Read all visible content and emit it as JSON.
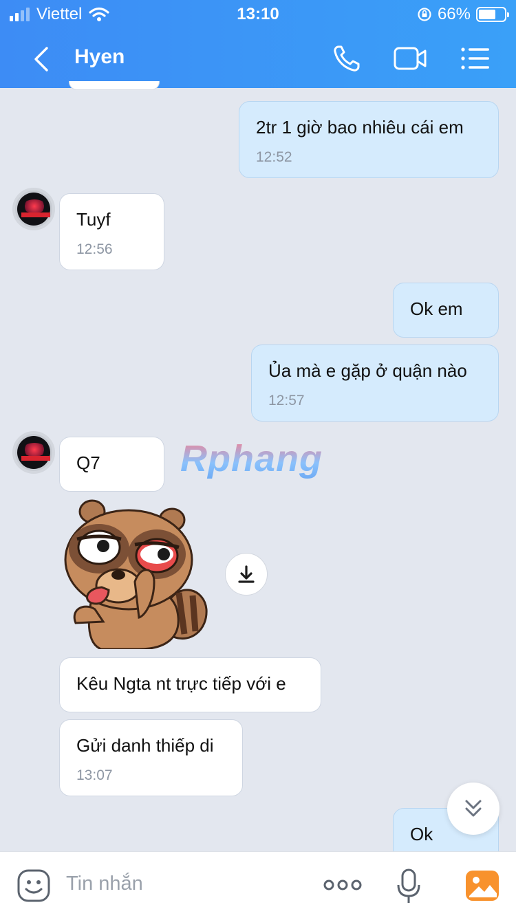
{
  "status_bar": {
    "carrier": "Viettel",
    "time": "13:10",
    "battery_percent": "66%",
    "battery_level": 0.66
  },
  "header": {
    "title": "Hyen",
    "back_icon": "chevron-left-icon",
    "call_icon": "phone-icon",
    "video_icon": "video-camera-icon",
    "menu_icon": "list-menu-icon",
    "accent": "#3d8cf5"
  },
  "messages": [
    {
      "direction": "out",
      "text": "2tr 1 giờ bao nhiêu cái em",
      "time": "12:52"
    },
    {
      "direction": "in",
      "text": "Tuyf",
      "time": "12:56"
    },
    {
      "direction": "out",
      "text": "Ok em",
      "time": ""
    },
    {
      "direction": "out",
      "text": "Ủa mà e gặp ở quận nào",
      "time": "12:57"
    },
    {
      "direction": "in",
      "text": "Q7",
      "time": ""
    },
    {
      "direction": "in",
      "type": "sticker",
      "sticker": "tanuki-tongue-sticker"
    },
    {
      "direction": "in",
      "text": "Kêu Ngta nt trực tiếp với e",
      "time": ""
    },
    {
      "direction": "in",
      "text": "Gửi danh thiếp di",
      "time": "13:07"
    },
    {
      "direction": "out",
      "text": "Ok",
      "time": ""
    }
  ],
  "watermark": "Rphang",
  "composer": {
    "placeholder": "Tin nhắn",
    "emoji_icon": "emoji-icon",
    "more_icon": "more-dots-icon",
    "mic_icon": "microphone-icon",
    "photo_icon": "photo-gallery-icon"
  }
}
